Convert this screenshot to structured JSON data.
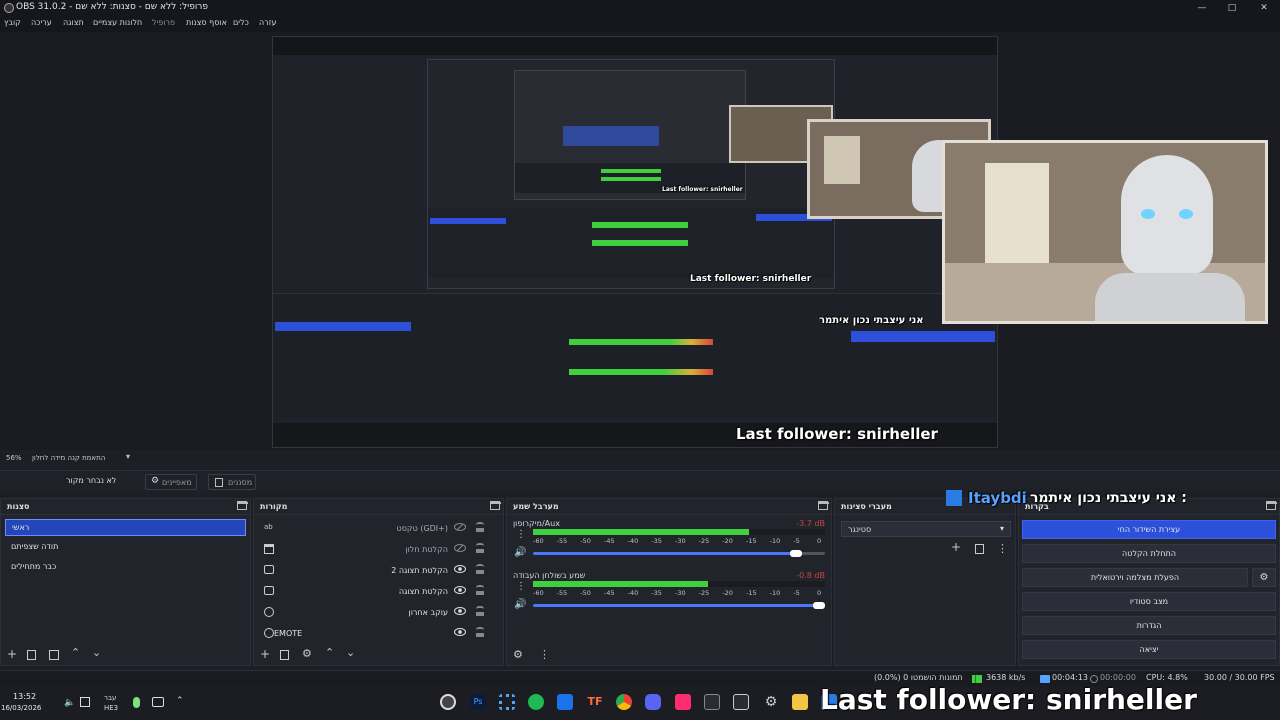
{
  "window": {
    "title": "OBS 31.0.2 - פרופיל: ללא שם - סצנות: ללא שם",
    "controls": [
      "minimize",
      "maximize",
      "close"
    ]
  },
  "menu": {
    "items": [
      "קובץ",
      "עריכה",
      "תצוגה",
      "חלונות עצמיים",
      "פרופיל",
      "אוסף סצנות",
      "כלים",
      "עזרה"
    ]
  },
  "preview": {
    "zoom_label": "56%",
    "scale_label": "התאמת קנה מידה לחלון",
    "nested_follower_small": "Last follower: snirheller",
    "nested_follower_mid": "Last follower: snirheller",
    "nested_follower_large": "Last follower: snirheller",
    "nested_chat_message": "אני עיצבתי נכון איתמר"
  },
  "source_bar": {
    "no_source": "לא נבחר מקור",
    "properties": "מאפיינים",
    "filters": "מסננים"
  },
  "scenes": {
    "title": "סצנות",
    "items": [
      {
        "label": "ראשי",
        "selected": true
      },
      {
        "label": "תודה שצפיתם",
        "selected": false
      },
      {
        "label": "כבר מתחילים",
        "selected": false
      }
    ]
  },
  "sources": {
    "title": "מקורות",
    "items": [
      {
        "label": "טקסט (GDI+)",
        "icon": "text-icon",
        "visible": false,
        "active": false
      },
      {
        "label": "הקלטת חלון",
        "icon": "window-icon",
        "visible": false,
        "active": false
      },
      {
        "label": "הקלטת תצוגה 2",
        "icon": "display-icon",
        "visible": true,
        "active": true
      },
      {
        "label": "הקלטת תצוגה",
        "icon": "display-icon",
        "visible": true,
        "active": true
      },
      {
        "label": "עוקב אחרון",
        "icon": "browser-icon",
        "visible": true,
        "active": true
      },
      {
        "label": "EMOTE",
        "icon": "browser-icon",
        "visible": true,
        "active": true
      }
    ]
  },
  "mixer": {
    "title": "מערבל שמע",
    "channels": [
      {
        "name": "מיקרופון/Aux",
        "db": "-3.7 dB",
        "level": 0.74,
        "volume": 0.9
      },
      {
        "name": "שמע בשולחן העבודה",
        "db": "-0.8 dB",
        "level": 0.6,
        "volume": 0.98
      }
    ],
    "ticks": [
      "-60",
      "-55",
      "-50",
      "-45",
      "-40",
      "-35",
      "-30",
      "-25",
      "-20",
      "-15",
      "-10",
      "-5",
      "0"
    ]
  },
  "transitions": {
    "title": "מעברי סצינות",
    "selected": "סטינגר"
  },
  "controls": {
    "title": "בקרות",
    "buttons": [
      {
        "label": "עצירת השידור החי",
        "primary": true
      },
      {
        "label": "התחלת הקלטה",
        "primary": false
      },
      {
        "label": "הפעלת מצלמה וירטואלית",
        "primary": false
      },
      {
        "label": "מצב סטודיו",
        "primary": false
      },
      {
        "label": "הגדרות",
        "primary": false
      },
      {
        "label": "יציאה",
        "primary": false
      }
    ]
  },
  "overlay": {
    "chat_message": "אני עיצבתי נכון איתמר :",
    "chat_user": "Itaybdi",
    "follower": "Last follower: snirheller"
  },
  "status": {
    "frames": "(0.0%) 0 תמונות הושמטו",
    "bitrate": "3638 kb/s",
    "live_time": "00:04:13",
    "rec_time": "00:00:00",
    "cpu": "CPU: 4.8%",
    "fps": "30.00 / 30.00 FPS"
  },
  "taskbar": {
    "time": "13:52",
    "date": "16/03/2026",
    "lang_top": "עבר",
    "lang_bottom": "HE3"
  },
  "colors": {
    "accent": "#2c50d9",
    "selection": "#2347b8",
    "meter_green": "#3fcf3f",
    "meter_yellow": "#d9b13a",
    "meter_red": "#d9463a"
  }
}
